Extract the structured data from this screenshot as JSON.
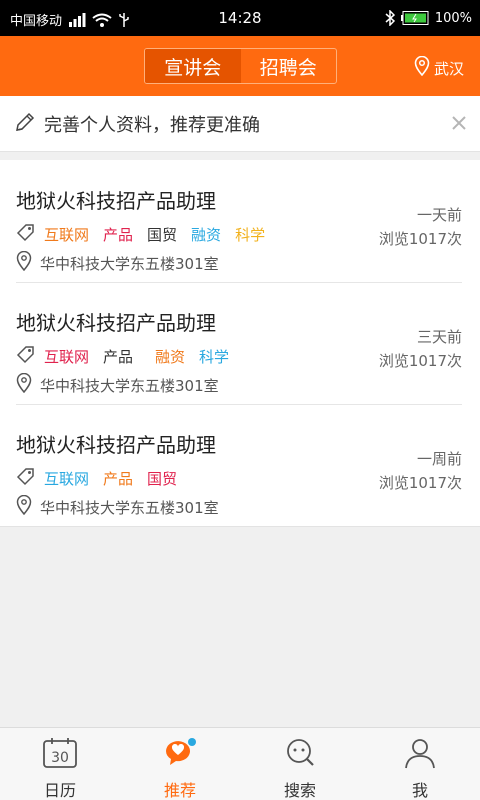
{
  "statusbar": {
    "carrier": "中国移动",
    "time": "14:28",
    "battery": "100%"
  },
  "header": {
    "tabs": [
      {
        "label": "宣讲会",
        "active": true
      },
      {
        "label": "招聘会",
        "active": false
      }
    ],
    "city": "武汉",
    "accent": "#ff6a10"
  },
  "tip": {
    "text": "完善个人资料，推荐更准确"
  },
  "items": [
    {
      "title": "地狱火科技招产品助理",
      "tags": [
        {
          "label": "互联网",
          "color": "#f07a1c"
        },
        {
          "label": "产品",
          "color": "#e0234e"
        },
        {
          "label": "国贸",
          "color": "#333333"
        },
        {
          "label": "融资",
          "color": "#29a8e0"
        },
        {
          "label": "科学",
          "color": "#f2b21e"
        }
      ],
      "location": "华中科技大学东五楼301室",
      "when": "一天前",
      "views": "浏览1017次"
    },
    {
      "title": "地狱火科技招产品助理",
      "tags": [
        {
          "label": "互联网",
          "color": "#e0234e"
        },
        {
          "label": "产品",
          "color": "#333333"
        },
        {
          "label": "融资",
          "color": "#f07a1c"
        },
        {
          "label": "科学",
          "color": "#29a8e0"
        }
      ],
      "location": "华中科技大学东五楼301室",
      "when": "三天前",
      "views": "浏览1017次"
    },
    {
      "title": "地狱火科技招产品助理",
      "tags": [
        {
          "label": "互联网",
          "color": "#29a8e0"
        },
        {
          "label": "产品",
          "color": "#f07a1c"
        },
        {
          "label": "国贸",
          "color": "#e0234e"
        }
      ],
      "location": "华中科技大学东五楼301室",
      "when": "一周前",
      "views": "浏览1017次"
    }
  ],
  "bottomnav": [
    {
      "label": "日历",
      "icon": "calendar-icon",
      "calendar_day": "30",
      "active": false
    },
    {
      "label": "推荐",
      "icon": "heart-chat-icon",
      "active": true
    },
    {
      "label": "搜索",
      "icon": "search-face-icon",
      "active": false
    },
    {
      "label": "我",
      "icon": "person-icon",
      "active": false
    }
  ]
}
